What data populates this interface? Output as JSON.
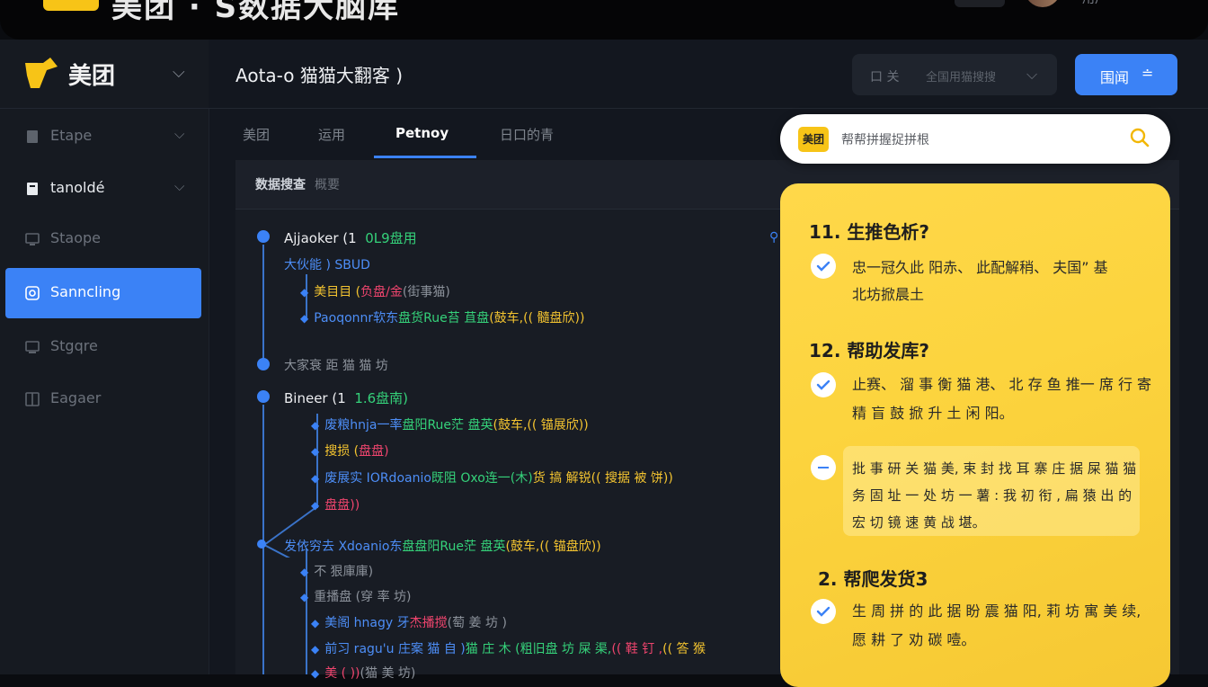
{
  "topbar": {
    "title": "美团 · S数据大脑库",
    "user": "用户"
  },
  "brand": {
    "name": "美团"
  },
  "sidebar": {
    "items": [
      {
        "label": "Etape",
        "has_chevron": true
      },
      {
        "label": "tanoldé",
        "has_chevron": true
      },
      {
        "label": "Staope"
      },
      {
        "label": "Sanncling",
        "active": true
      },
      {
        "label": "Stgqre"
      },
      {
        "label": "Eagaer"
      }
    ]
  },
  "header": {
    "title": "Aota-o 猫猫大翻客 )",
    "select_prefix": "口 关",
    "select_text": "全国用猫搜搜",
    "button_label": "围闻"
  },
  "tabs": [
    {
      "label": "美团"
    },
    {
      "label": "运用"
    },
    {
      "label": "Petnoy",
      "active": true
    },
    {
      "label": "日口的青"
    }
  ],
  "panel": {
    "title": "数据搜查",
    "subtitle": "概要"
  },
  "tree": {
    "n1": {
      "name": "Ajjaoker (1",
      "meta": "0L9盘用"
    },
    "n1_sub": "大伙能 ) SBUD",
    "n1_c1": {
      "a": "美目目 (",
      "b": "负盘/金",
      "c": "(街事猫)"
    },
    "n1_c2": {
      "a": "Paoqonnr软东",
      "b": "盘货Rue苔 苴盘",
      "c": "(鼓车,",
      "d": "(( 髓盘欣))"
    },
    "n2": {
      "name": "大家衰 距 猫 猫 坊"
    },
    "n3": {
      "name": "Bineer (1",
      "meta": "1.6盘南)"
    },
    "n3_c1": {
      "a": "废粮hnja一率",
      "b": "盘阳Rue茫 盘英",
      "c": "(鼓车,",
      "d": "(( 锚展欣))"
    },
    "n3_c2": {
      "a": "搜损 (",
      "b": "盘盘)"
    },
    "n3_c3": {
      "a": "废展实 IORdoanio",
      "b": "既阻 Oxo连一(木)",
      "c": "货 搞 解锐",
      "d": "(( 搜据 被 饼))"
    },
    "n3_c4": {
      "a": "盘盘))"
    },
    "n4": {
      "a": "发依穷去 Xdoanio东",
      "b": "盘盘阳Rue茫 盘英",
      "c": "(鼓车,",
      "d": "(( 锚盘欣))"
    },
    "n4_c1": "不 狠庫庫)",
    "n4_c2": "重播盘 (穿 率 坊)",
    "n4_c3": {
      "a": "美阁 hnagy 牙",
      "b": "杰播搅",
      "c": "(萄 姜 坊 )"
    },
    "n4_c4": {
      "a": "前习 ragu'u 庄案 猫 自 )",
      "b": "猫 庄 木 (粗旧盘 坊 屎 渠,",
      "c": "(( 鞋 钉 ,",
      "d": "(( 答 猴"
    },
    "n4_c5": {
      "a": "美 ( ))",
      "b": "(猫 美 坊)"
    }
  },
  "search": {
    "placeholder": "帮帮拼握捉拼根",
    "logo": "美团"
  },
  "faq": {
    "q1": {
      "title": "11. 生推色析?",
      "line1": "忠一冠久此 阳赤、 此配解稍、 夫国” 基",
      "line2": "北坊掀晨土"
    },
    "q2": {
      "title": "12. 帮助发库?",
      "line1": "止赛、 溜 事 衡 猫 港、 北 存 鱼 推一 席 行 寄",
      "line2": "精 盲 鼓 掀 升 土 闲 阳。"
    },
    "note": {
      "line1": "批 事 研 关 猫 美, 束 封 找 耳 寨 庄 据 屎 猫 猫",
      "line2": "务 固 址 一 处 坊 一 薯 : 我 初 衔 , 扁 猿 出 的",
      "line3": "宏 切 镜 速 黄 战 堪。"
    },
    "q3": {
      "title": "2. 帮爬发货3",
      "line1": "生 周 拼 的 此 据 盼 震 猫 阳, 莉 坊 寓 美 续,",
      "line2": "愿 耕 了 劝 碳 噎。"
    }
  },
  "colors": {
    "accent": "#3b82f6",
    "brand_yellow": "#f7c417",
    "green": "#35d27a",
    "yellow_text": "#f4c430",
    "pink": "#f0456e"
  }
}
